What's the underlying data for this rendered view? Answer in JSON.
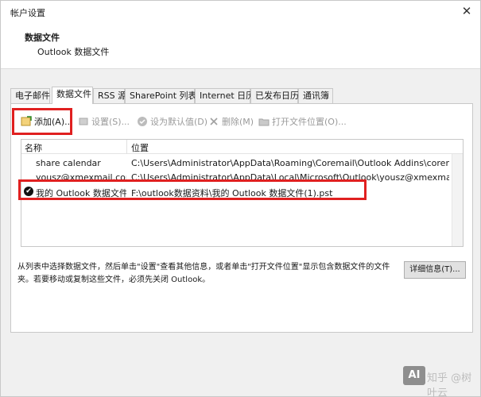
{
  "window": {
    "title": "帐户设置",
    "close_glyph": "✕"
  },
  "header": {
    "title": "数据文件",
    "subtitle": "Outlook 数据文件"
  },
  "tabs": [
    {
      "label": "电子邮件"
    },
    {
      "label": "数据文件",
      "active": true
    },
    {
      "label": "RSS 源"
    },
    {
      "label": "SharePoint 列表"
    },
    {
      "label": "Internet 日历"
    },
    {
      "label": "已发布日历"
    },
    {
      "label": "通讯簿"
    }
  ],
  "toolbar": {
    "add": "添加(A)...",
    "settings": "设置(S)...",
    "set_default": "设为默认值(D)",
    "remove": "删除(M)",
    "open_location": "打开文件位置(O)..."
  },
  "list": {
    "col_name": "名称",
    "col_location": "位置",
    "rows": [
      {
        "name": "share calendar",
        "location": "C:\\Users\\Administrator\\AppData\\Roaming\\Coremail\\Outlook Addins\\coremail...."
      },
      {
        "name": "yousz@xmexmail.com",
        "location": "C:\\Users\\Administrator\\AppData\\Local\\Microsoft\\Outlook\\yousz@xmexmail.co..."
      },
      {
        "name": "我的 Outlook 数据文件...",
        "location": "F:\\outlook数据资料\\我的 Outlook 数据文件(1).pst",
        "default": true
      }
    ]
  },
  "description": "从列表中选择数据文件，然后单击\"设置\"查看其他信息，或者单击\"打开文件位置\"显示包含数据文件的文件夹。若要移动或复制这些文件，必须先关闭 Outlook。",
  "details_button": "详细信息(T)...",
  "watermark": {
    "logo": "AI",
    "text": "知乎 @树叶云"
  },
  "colors": {
    "highlight": "#e02020",
    "panel": "#ffffff",
    "chrome": "#f0f0f0"
  }
}
